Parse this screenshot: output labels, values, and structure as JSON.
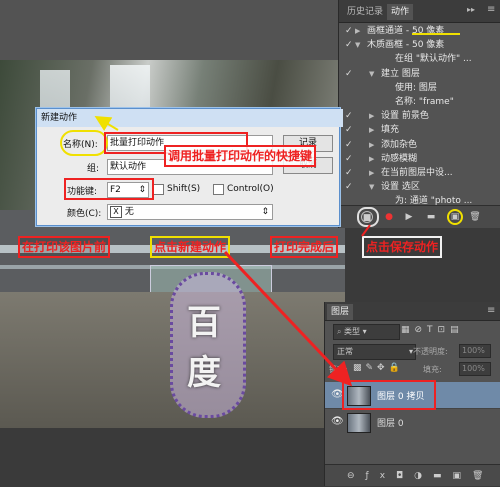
{
  "actions_panel": {
    "tabs": [
      "历史记录",
      "动作"
    ],
    "rows": [
      {
        "text": "画框通道 - 50 像素",
        "level": 1,
        "checked": true,
        "expanded": false
      },
      {
        "text": "木质画框 - 50 像素",
        "level": 1,
        "checked": true,
        "expanded": true
      },
      {
        "text": "在组 \"默认动作\" ...",
        "level": 3,
        "checked": false,
        "expanded": null
      },
      {
        "text": "建立 图层",
        "level": 2,
        "checked": true,
        "expanded": true
      },
      {
        "text": "使用: 图层",
        "level": 3,
        "checked": false,
        "expanded": null
      },
      {
        "text": "名称: \"frame\"",
        "level": 3,
        "checked": false,
        "expanded": null
      },
      {
        "text": "设置 前景色",
        "level": 2,
        "checked": true,
        "expanded": false
      },
      {
        "text": "填充",
        "level": 2,
        "checked": true,
        "expanded": false
      },
      {
        "text": "添加杂色",
        "level": 2,
        "checked": true,
        "expanded": false
      },
      {
        "text": "动感模糊",
        "level": 2,
        "checked": true,
        "expanded": false
      },
      {
        "text": "在当前图层中设...",
        "level": 2,
        "checked": true,
        "expanded": false
      },
      {
        "text": "设置 选区",
        "level": 2,
        "checked": true,
        "expanded": true
      },
      {
        "text": "为: 通道 \"photo ...",
        "level": 3,
        "checked": false,
        "expanded": null
      }
    ]
  },
  "dialog": {
    "title": "新建动作",
    "name_label": "名称(N):",
    "name_value": "批量打印动作",
    "group_label": "组:",
    "group_value": "默认动作",
    "fkey_label": "功能键:",
    "fkey_value": "F2",
    "shift_label": "Shift(S)",
    "control_label": "Control(O)",
    "color_label": "颜色(C):",
    "color_value": "无",
    "color_x": "X",
    "record_button": "记录",
    "cancel_button": "取消"
  },
  "layers_panel": {
    "tab": "图层",
    "kind_select": "类型",
    "blend_mode": "正常",
    "opacity_label": "不透明度:",
    "opacity_value": "100%",
    "lock_label": "锁定:",
    "fill_label": "填充:",
    "fill_value": "100%",
    "layers": [
      {
        "name": "图层 0 拷贝",
        "selected": true
      },
      {
        "name": "图层 0",
        "selected": false
      }
    ]
  },
  "annotations": {
    "hotkey_note": "调用批量打印动作的快捷键",
    "step1": "在打印该图片前",
    "step2": "点击新建动作",
    "step3": "打印完成后",
    "step4": "点击保存动作",
    "watermark": [
      "百",
      "度"
    ]
  },
  "colors": {
    "annotation_red": "#e22222",
    "annotation_yellow": "#f0e000",
    "dialog_title": "#cfe0f3"
  }
}
